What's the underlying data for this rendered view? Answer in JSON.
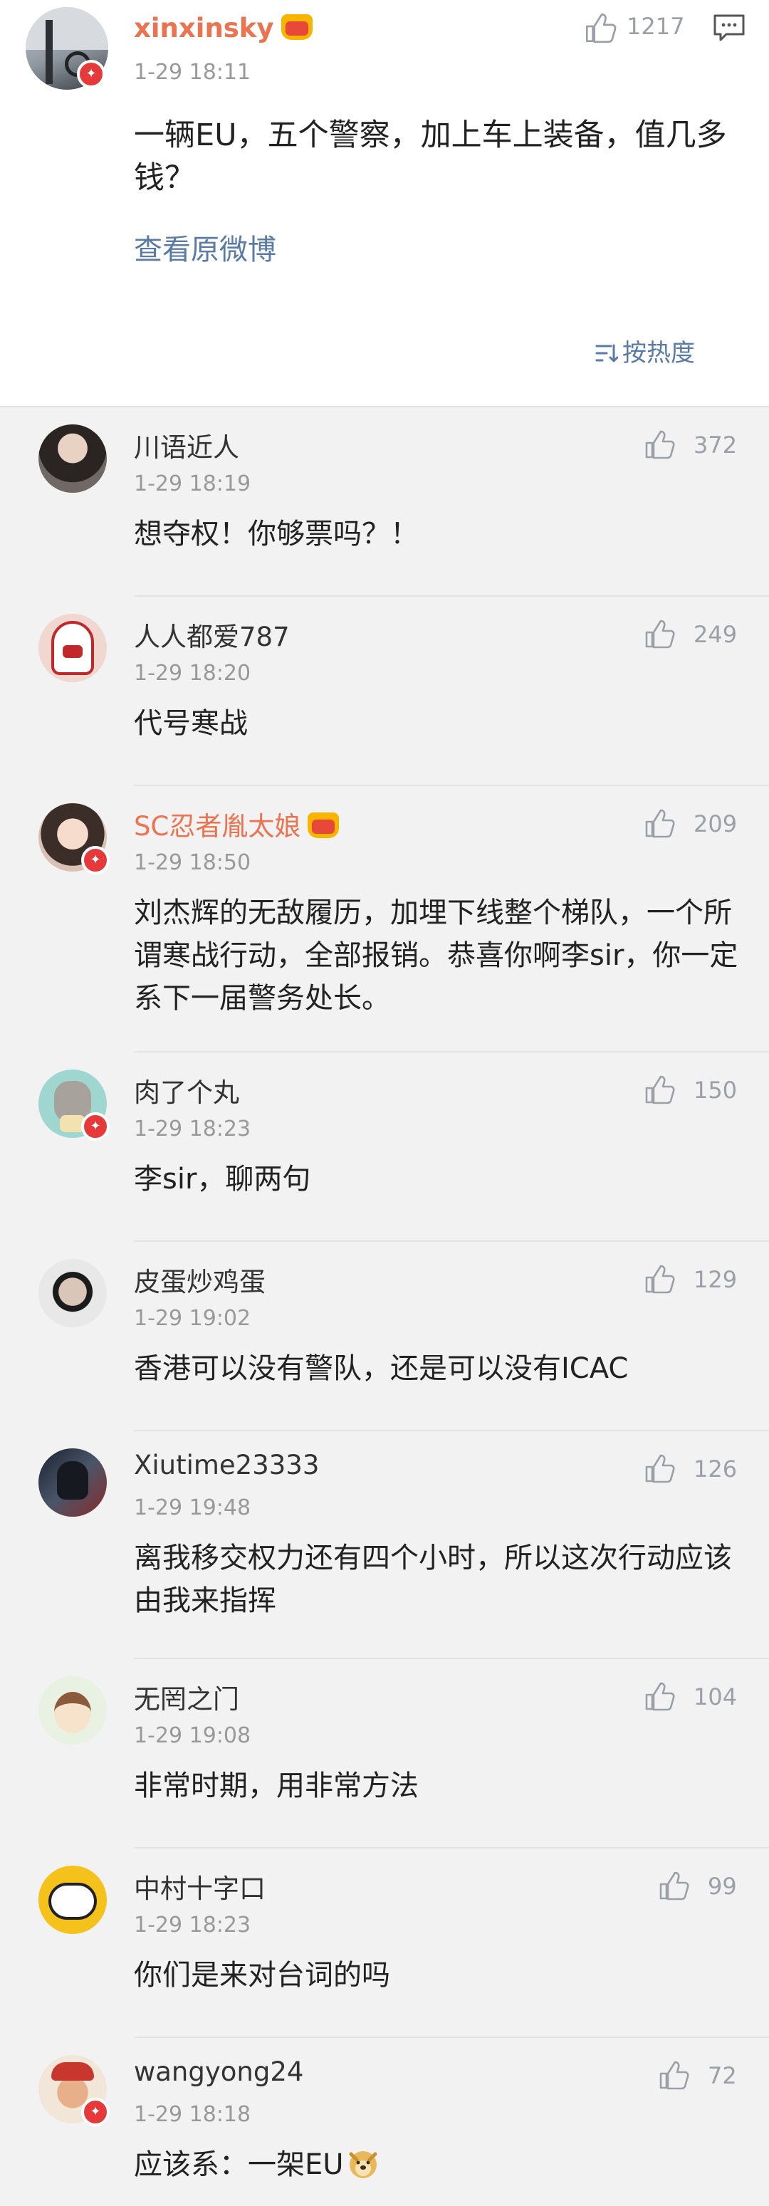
{
  "post": {
    "username": "xinxinsky",
    "time": "1-29 18:11",
    "like_count": "1217",
    "text": "一辆EU，五个警察，加上车上装备，值几多钱？",
    "view_original": "查看原微博",
    "sort_label": "按热度"
  },
  "comments": [
    {
      "username": "川语近人",
      "time": "1-29 18:19",
      "text": "想夺权！你够票吗？！",
      "likes": "372"
    },
    {
      "username": "人人都爱787",
      "time": "1-29 18:20",
      "text": "代号寒战",
      "likes": "249"
    },
    {
      "username": "SC忍者胤太娘",
      "time": "1-29 18:50",
      "text": "刘杰辉的无敌履历，加埋下线整个梯队，一个所谓寒战行动，全部报销。恭喜你啊李sir，你一定系下一届警务处长。",
      "likes": "209"
    },
    {
      "username": "肉了个丸",
      "time": "1-29 18:23",
      "text": "李sir，聊两句",
      "likes": "150"
    },
    {
      "username": "皮蛋炒鸡蛋",
      "time": "1-29 19:02",
      "text": "香港可以没有警队，还是可以没有ICAC",
      "likes": "129"
    },
    {
      "username": "Xiutime23333",
      "time": "1-29 19:48",
      "text": "离我移交权力还有四个小时，所以这次行动应该由我来指挥",
      "likes": "126"
    },
    {
      "username": "无罔之门",
      "time": "1-29 19:08",
      "text": "非常时期，用非常方法",
      "likes": "104"
    },
    {
      "username": "中村十字口",
      "time": "1-29 18:23",
      "text": "你们是来对台词的吗",
      "likes": "99"
    },
    {
      "username": "wangyong24",
      "time": "1-29 18:18",
      "text": "应该系：一架EU",
      "likes": "72"
    }
  ]
}
